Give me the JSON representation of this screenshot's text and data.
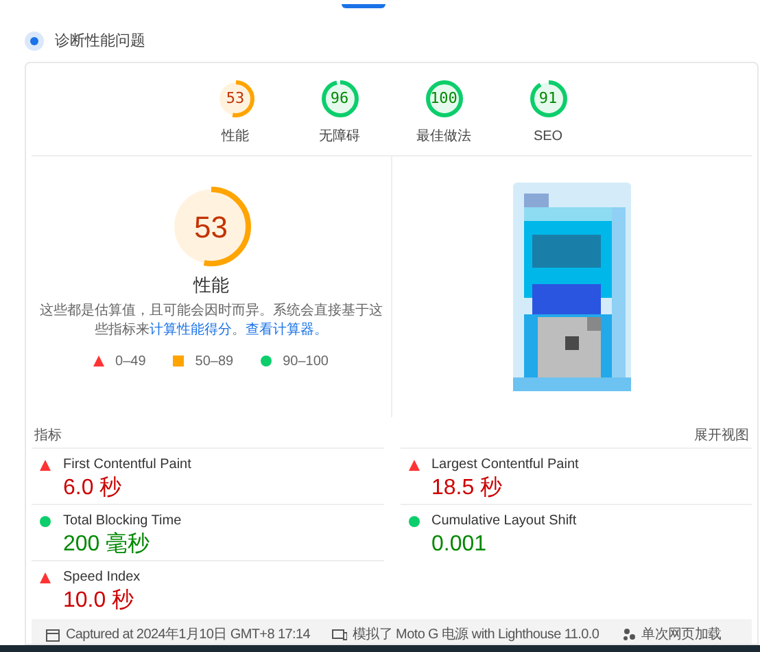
{
  "header": {
    "title": "诊断性能问题"
  },
  "scores": [
    {
      "value": "53",
      "label": "性能",
      "color": "#ffa400"
    },
    {
      "value": "96",
      "label": "无障碍",
      "color": "#0cce6b"
    },
    {
      "value": "100",
      "label": "最佳做法",
      "color": "#0cce6b"
    },
    {
      "value": "91",
      "label": "SEO",
      "color": "#0cce6b"
    }
  ],
  "performance": {
    "score": "53",
    "color": "#ffa400",
    "title": "性能",
    "description": [
      {
        "kind": "text",
        "text": "这些都是估算值，且可能会因时而异。系统会直接基于这些指标来"
      },
      {
        "kind": "link",
        "text": "计算性能得分"
      },
      {
        "kind": "text",
        "text": "。"
      },
      {
        "kind": "link",
        "text": "查看计算器。"
      }
    ]
  },
  "legend": [
    {
      "kind": "triangle",
      "color": "#ff3333",
      "label": "0–49"
    },
    {
      "kind": "square",
      "color": "#ffa400",
      "label": "50–89"
    },
    {
      "kind": "circle",
      "color": "#0cce6b",
      "label": "90–100"
    }
  ],
  "metrics": {
    "title": "指标",
    "toggle": "展开视图",
    "items": [
      {
        "name": "First Contentful Paint",
        "value": "6.0 秒",
        "kind": "triangle",
        "color": "#ff3333"
      },
      {
        "name": "Largest Contentful Paint",
        "value": "18.5 秒",
        "kind": "triangle",
        "color": "#ff3333"
      },
      {
        "name": "Total Blocking Time",
        "value": "200 毫秒",
        "kind": "circle",
        "color": "#0cce6b"
      },
      {
        "name": "Cumulative Layout Shift",
        "value": "0.001",
        "kind": "circle",
        "color": "#0cce6b"
      },
      {
        "name": "Speed Index",
        "value": "10.0 秒",
        "kind": "triangle",
        "color": "#ff3333"
      }
    ]
  },
  "footer": [
    {
      "kind": "calendar",
      "text": "Captured at 2024年1月10日 GMT+8 17:14"
    },
    {
      "kind": "device",
      "text": "模拟了 Moto G 电源 with Lighthouse 11.0.0"
    },
    {
      "kind": "users",
      "text": "单次网页加载"
    }
  ]
}
